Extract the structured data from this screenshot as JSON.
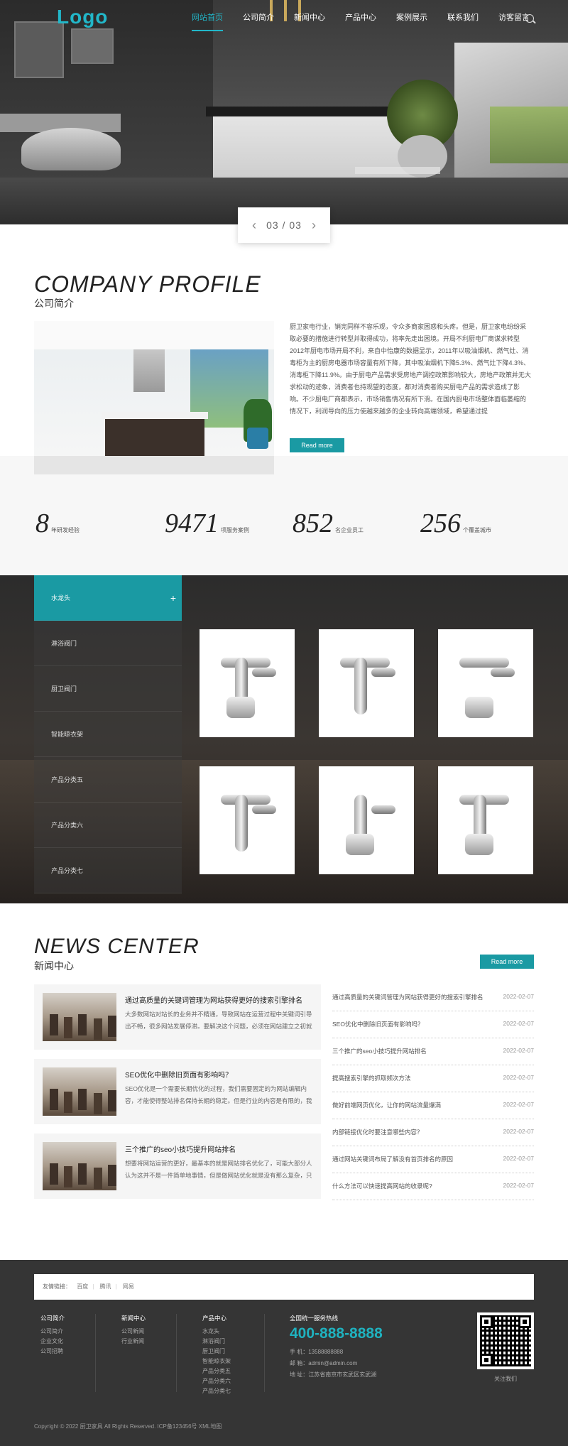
{
  "header": {
    "logo": "Logo",
    "nav": [
      "网站首页",
      "公司简介",
      "新闻中心",
      "产品中心",
      "案例展示",
      "联系我们",
      "访客留言"
    ]
  },
  "hero": {
    "counter": "03 / 03",
    "prev": "‹",
    "next": "›"
  },
  "profile": {
    "title": "COMPANY PROFILE",
    "subtitle": "公司简介",
    "text": "厨卫家电行业，销完同样不容乐观，令众多商家困惑和头疼。但是，厨卫家电纷纷采取必要的措施进行转型并取得成功，将率先走出困境。开局不利厨电厂商谋求转型2012年厨电市场开局不利，来自中怡康的数据显示，2011年以吸油烟机、燃气灶、消毒柜为主的厨房电器市场容量有所下降，其中吸油烟机下降5.3%、燃气灶下降4.3%、消毒柜下降11.9%。由于厨电产品需求受房地产调控政策影响较大，房地产政策并无大求松动的迹象，消费者也持观望的态度，都对消费者购买厨电产品的需求造成了影响。不少厨电厂商都表示，市场销售情况有所下滑。在国内厨电市场整体面临萎缩的情况下，利润导向的压力使越来越多的企业转向高端领域，希望通过提",
    "button": "Read more"
  },
  "stats": [
    {
      "num": "8",
      "label": "年研发经验"
    },
    {
      "num": "9471",
      "label": "项服务案例"
    },
    {
      "num": "852",
      "label": "名企业员工"
    },
    {
      "num": "256",
      "label": "个覆盖城市"
    }
  ],
  "products": {
    "categories": [
      "水龙头",
      "淋浴阀门",
      "厨卫阀门",
      "智能晾衣架",
      "产品分类五",
      "产品分类六",
      "产品分类七"
    ],
    "plus": "+"
  },
  "news": {
    "title": "NEWS CENTER",
    "subtitle": "新闻中心",
    "button": "Read more",
    "cards": [
      {
        "title": "通过高质量的关键词管理为网站获得更好的搜索引擎排名",
        "excerpt": "大多数网站对站长的业务并不精通，导致网站在运营过程中关键词引导出不畅，很多网站发展停滞。要解决这个问题，必须在网站建立之初就对关键词进行"
      },
      {
        "title": "SEO优化中删除旧页面有影响吗？",
        "excerpt": "SEO优化是一个需要长期优化的过程，我们需要固定的为网站编辑内容，才能使得整站排名保持长期的稳定。但是行业的内容是有限的，我们不可"
      },
      {
        "title": "三个推广的seo小技巧提升网站排名",
        "excerpt": "想要将网站运营的更好，最基本的就是网站排名优化了，可能大部分人认为这并不是一件简单地事情，但是做网站优化就是没有那么复杂，只需"
      }
    ],
    "list": [
      {
        "title": "通过高质量的关键词管理为网站获得更好的搜索引擎排名",
        "date": "2022-02-07"
      },
      {
        "title": "SEO优化中删除旧页面有影响吗？",
        "date": "2022-02-07"
      },
      {
        "title": "三个推广的seo小技巧提升网站排名",
        "date": "2022-02-07"
      },
      {
        "title": "提高搜索引擎的抓取频次方法",
        "date": "2022-02-07"
      },
      {
        "title": "做好前端网页优化，让你的网站流量爆满",
        "date": "2022-02-07"
      },
      {
        "title": "内部链接优化时要注意哪些内容？",
        "date": "2022-02-07"
      },
      {
        "title": "通过网站关键词布局了解没有首页排名的原因",
        "date": "2022-02-07"
      },
      {
        "title": "什么方法可以快速提高网站的收录呢?",
        "date": "2022-02-07"
      }
    ]
  },
  "footer": {
    "links_label": "友情链接：",
    "links": [
      "百度",
      "腾讯",
      "网易"
    ],
    "cols": [
      {
        "title": "公司简介",
        "items": [
          "公司简介",
          "企业文化",
          "公司招聘"
        ]
      },
      {
        "title": "新闻中心",
        "items": [
          "公司新闻",
          "行业新闻"
        ]
      },
      {
        "title": "产品中心",
        "items": [
          "水龙头",
          "淋浴阀门",
          "厨卫阀门",
          "智能晾衣架",
          "产品分类五",
          "产品分类六",
          "产品分类七"
        ]
      }
    ],
    "hotline_label": "全国统一服务热线",
    "phone": "400-888-8888",
    "mobile": "手 机：13588888888",
    "email": "邮 箱：admin@admin.com",
    "address": "地 址：江苏省南京市玄武区玄武湖",
    "qr_label": "关注我们",
    "copyright": "Copyright © 2022 厨卫家具 All Rights Reserved.",
    "icp": "ICP备123456号",
    "sitemap": "XML地图"
  },
  "colors": {
    "accent": "#1a9aa3",
    "logo": "#22b7c9",
    "footer": "#353535"
  }
}
